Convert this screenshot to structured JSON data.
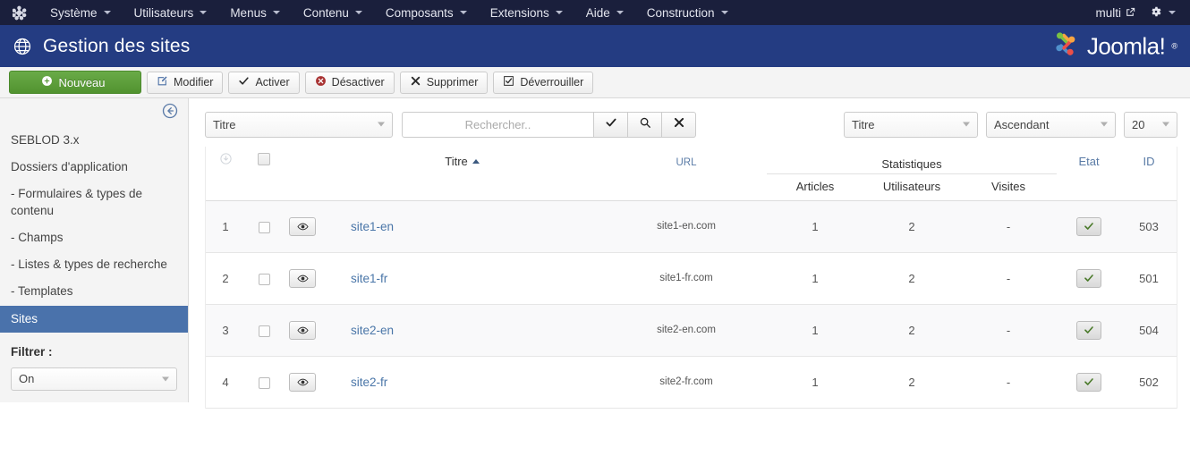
{
  "topbar": {
    "logo_icon": "joomla-mark-icon",
    "menu": [
      {
        "label": "Système",
        "icon": "chevron-down-icon"
      },
      {
        "label": "Utilisateurs",
        "icon": "chevron-down-icon"
      },
      {
        "label": "Menus",
        "icon": "chevron-down-icon"
      },
      {
        "label": "Contenu",
        "icon": "chevron-down-icon"
      },
      {
        "label": "Composants",
        "icon": "chevron-down-icon"
      },
      {
        "label": "Extensions",
        "icon": "chevron-down-icon"
      },
      {
        "label": "Aide",
        "icon": "chevron-down-icon"
      },
      {
        "label": "Construction",
        "icon": "chevron-down-icon"
      }
    ],
    "site_name": "multi",
    "site_icon": "external-link-icon",
    "gear_icon": "gear-icon",
    "gear_caret_icon": "chevron-down-icon"
  },
  "header": {
    "icon": "globe-icon",
    "title": "Gestion des sites",
    "brand": "Joomla!",
    "brand_tm": "®"
  },
  "toolbar": {
    "buttons": [
      {
        "label": "Nouveau",
        "icon": "plus-circle-icon",
        "style": "primary"
      },
      {
        "label": "Modifier",
        "icon": "edit-pencil-icon",
        "style": "default"
      },
      {
        "label": "Activer",
        "icon": "check-icon",
        "style": "default"
      },
      {
        "label": "Désactiver",
        "icon": "x-circle-icon",
        "style": "default"
      },
      {
        "label": "Supprimer",
        "icon": "x-mark-icon",
        "style": "default"
      },
      {
        "label": "Déverrouiller",
        "icon": "checkbox-icon",
        "style": "default"
      }
    ]
  },
  "sidebar": {
    "collapse_icon": "arrow-left-circle-icon",
    "items": [
      {
        "label": "SEBLOD 3.x",
        "active": false
      },
      {
        "label": "Dossiers d'application",
        "active": false
      },
      {
        "label": "- Formulaires & types de contenu",
        "active": false
      },
      {
        "label": "- Champs",
        "active": false
      },
      {
        "label": "- Listes & types de recherche",
        "active": false
      },
      {
        "label": "- Templates",
        "active": false
      },
      {
        "label": "Sites",
        "active": true
      }
    ],
    "filter_label": "Filtrer :",
    "filter_value": "On",
    "filter_caret_icon": "chevron-down-icon"
  },
  "filterbar": {
    "field_select": "Titre",
    "search_placeholder": "Rechercher..",
    "search_value": "",
    "apply_icon": "check-icon",
    "search_icon": "search-icon",
    "clear_icon": "x-mark-icon",
    "sort_select": "Titre",
    "direction_select": "Ascendant",
    "limit_select": "20"
  },
  "table": {
    "headers": {
      "download_icon": "download-circle-icon",
      "select_all": "select-all-checkbox",
      "title": "Titre",
      "title_sort_icon": "sort-ascending-icon",
      "url": "URL",
      "stats_group": "Statistiques",
      "articles": "Articles",
      "users": "Utilisateurs",
      "visits": "Visites",
      "state": "Etat",
      "id": "ID"
    },
    "rows": [
      {
        "num": "1",
        "preview_icon": "eye-icon",
        "title": "site1-en",
        "url": "site1-en.com",
        "articles": "1",
        "users": "2",
        "visits": "-",
        "state_icon": "check-icon",
        "id": "503"
      },
      {
        "num": "2",
        "preview_icon": "eye-icon",
        "title": "site1-fr",
        "url": "site1-fr.com",
        "articles": "1",
        "users": "2",
        "visits": "-",
        "state_icon": "check-icon",
        "id": "501"
      },
      {
        "num": "3",
        "preview_icon": "eye-icon",
        "title": "site2-en",
        "url": "site2-en.com",
        "articles": "1",
        "users": "2",
        "visits": "-",
        "state_icon": "check-icon",
        "id": "504"
      },
      {
        "num": "4",
        "preview_icon": "eye-icon",
        "title": "site2-fr",
        "url": "site2-fr.com",
        "articles": "1",
        "users": "2",
        "visits": "-",
        "state_icon": "check-icon",
        "id": "502"
      }
    ]
  },
  "colors": {
    "topbar": "#1a1f3c",
    "header": "#243c82",
    "primary_button": "#51932f",
    "active_sidebar": "#4a72ab",
    "link": "#4a76a8"
  }
}
